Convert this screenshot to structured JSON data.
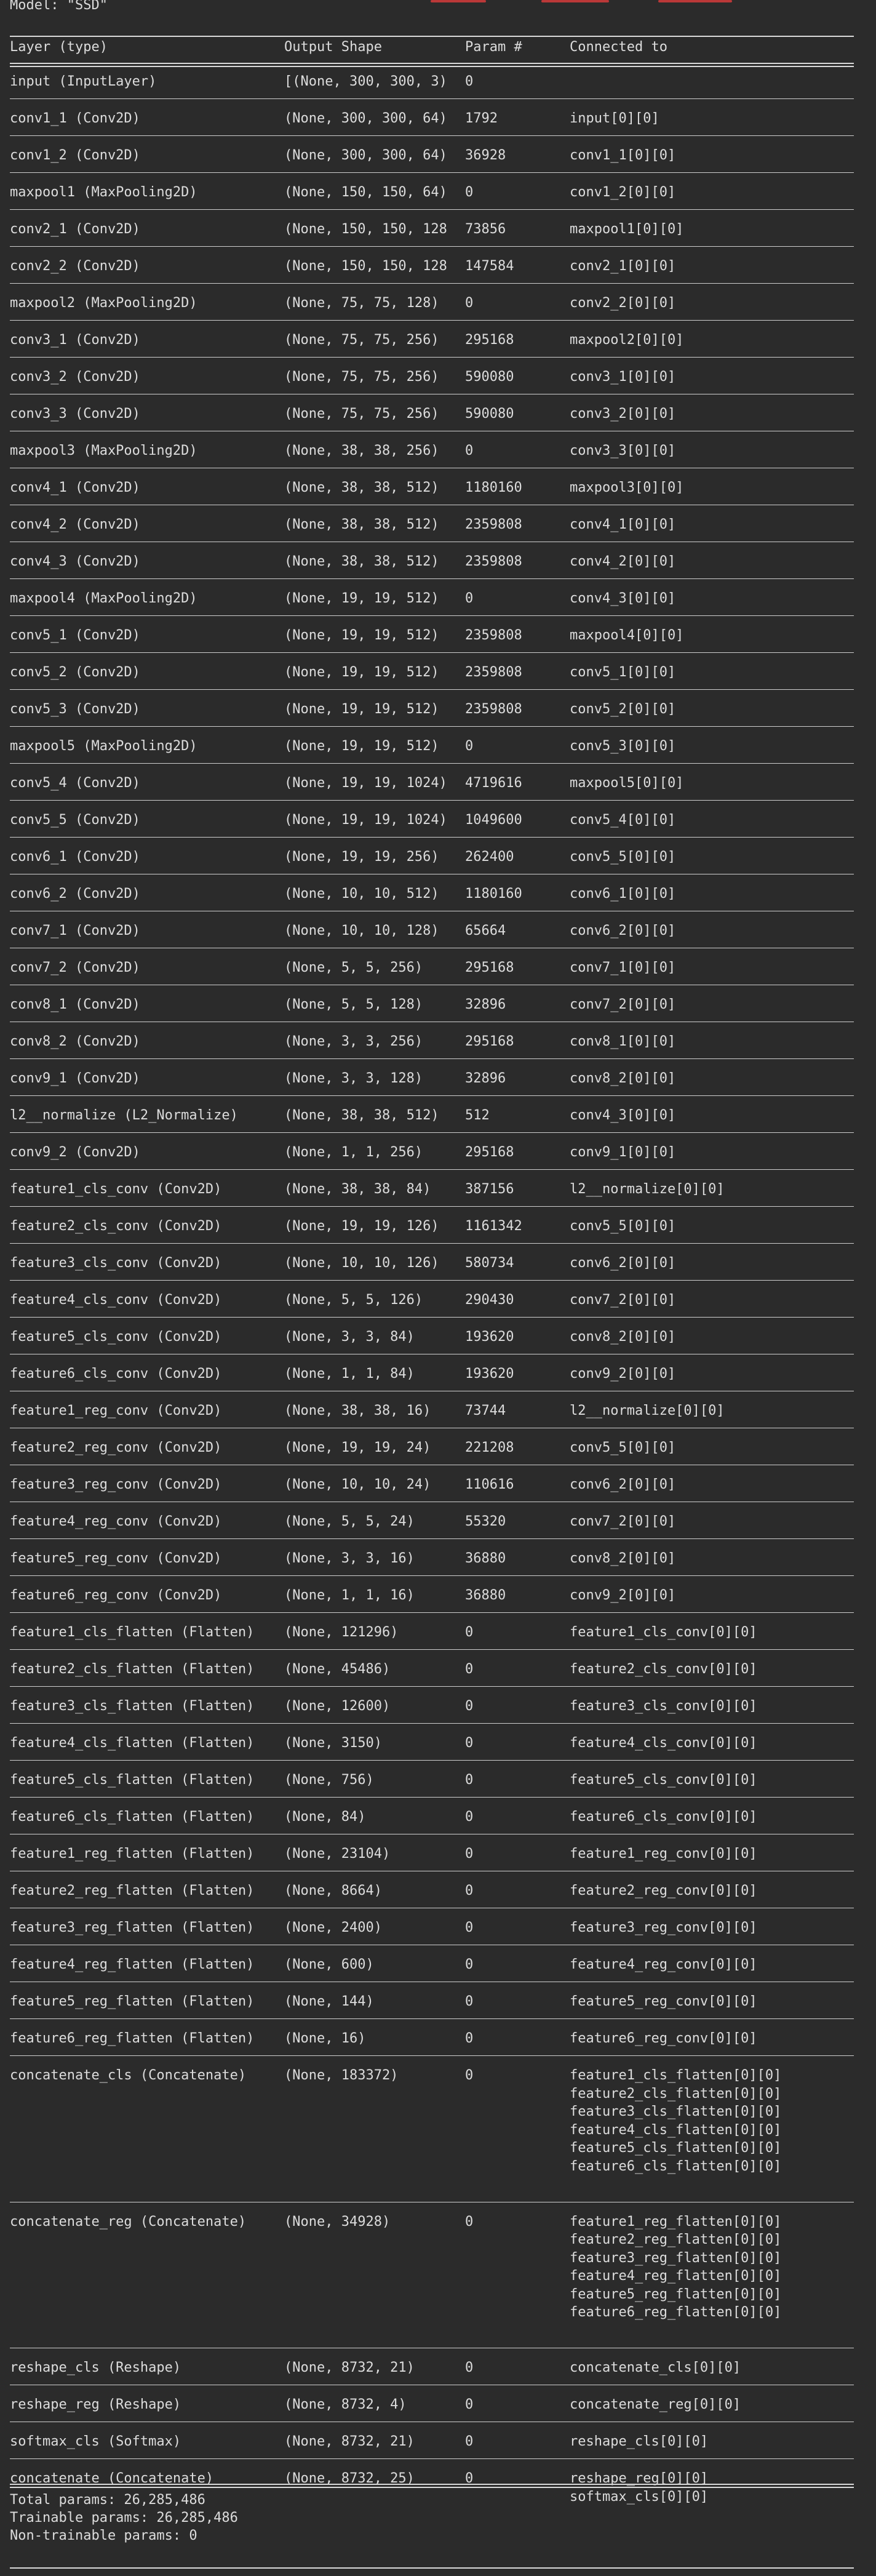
{
  "model_title": "Model: \"SSD\"",
  "header": {
    "layer": "Layer (type)",
    "shape": "Output Shape",
    "param": "Param #",
    "connected": "Connected to"
  },
  "rows": [
    {
      "layer": "input (InputLayer)",
      "shape": "[(None, 300, 300, 3)",
      "param": "0",
      "connected": [
        ""
      ]
    },
    {
      "layer": "conv1_1 (Conv2D)",
      "shape": "(None, 300, 300, 64)",
      "param": "1792",
      "connected": [
        "input[0][0]"
      ]
    },
    {
      "layer": "conv1_2 (Conv2D)",
      "shape": "(None, 300, 300, 64)",
      "param": "36928",
      "connected": [
        "conv1_1[0][0]"
      ]
    },
    {
      "layer": "maxpool1 (MaxPooling2D)",
      "shape": "(None, 150, 150, 64)",
      "param": "0",
      "connected": [
        "conv1_2[0][0]"
      ]
    },
    {
      "layer": "conv2_1 (Conv2D)",
      "shape": "(None, 150, 150, 128",
      "param": "73856",
      "connected": [
        "maxpool1[0][0]"
      ]
    },
    {
      "layer": "conv2_2 (Conv2D)",
      "shape": "(None, 150, 150, 128",
      "param": "147584",
      "connected": [
        "conv2_1[0][0]"
      ]
    },
    {
      "layer": "maxpool2 (MaxPooling2D)",
      "shape": "(None, 75, 75, 128)",
      "param": "0",
      "connected": [
        "conv2_2[0][0]"
      ]
    },
    {
      "layer": "conv3_1 (Conv2D)",
      "shape": "(None, 75, 75, 256)",
      "param": "295168",
      "connected": [
        "maxpool2[0][0]"
      ]
    },
    {
      "layer": "conv3_2 (Conv2D)",
      "shape": "(None, 75, 75, 256)",
      "param": "590080",
      "connected": [
        "conv3_1[0][0]"
      ]
    },
    {
      "layer": "conv3_3 (Conv2D)",
      "shape": "(None, 75, 75, 256)",
      "param": "590080",
      "connected": [
        "conv3_2[0][0]"
      ]
    },
    {
      "layer": "maxpool3 (MaxPooling2D)",
      "shape": "(None, 38, 38, 256)",
      "param": "0",
      "connected": [
        "conv3_3[0][0]"
      ]
    },
    {
      "layer": "conv4_1 (Conv2D)",
      "shape": "(None, 38, 38, 512)",
      "param": "1180160",
      "connected": [
        "maxpool3[0][0]"
      ]
    },
    {
      "layer": "conv4_2 (Conv2D)",
      "shape": "(None, 38, 38, 512)",
      "param": "2359808",
      "connected": [
        "conv4_1[0][0]"
      ]
    },
    {
      "layer": "conv4_3 (Conv2D)",
      "shape": "(None, 38, 38, 512)",
      "param": "2359808",
      "connected": [
        "conv4_2[0][0]"
      ]
    },
    {
      "layer": "maxpool4 (MaxPooling2D)",
      "shape": "(None, 19, 19, 512)",
      "param": "0",
      "connected": [
        "conv4_3[0][0]"
      ]
    },
    {
      "layer": "conv5_1 (Conv2D)",
      "shape": "(None, 19, 19, 512)",
      "param": "2359808",
      "connected": [
        "maxpool4[0][0]"
      ]
    },
    {
      "layer": "conv5_2 (Conv2D)",
      "shape": "(None, 19, 19, 512)",
      "param": "2359808",
      "connected": [
        "conv5_1[0][0]"
      ]
    },
    {
      "layer": "conv5_3 (Conv2D)",
      "shape": "(None, 19, 19, 512)",
      "param": "2359808",
      "connected": [
        "conv5_2[0][0]"
      ]
    },
    {
      "layer": "maxpool5 (MaxPooling2D)",
      "shape": "(None, 19, 19, 512)",
      "param": "0",
      "connected": [
        "conv5_3[0][0]"
      ]
    },
    {
      "layer": "conv5_4 (Conv2D)",
      "shape": "(None, 19, 19, 1024)",
      "param": "4719616",
      "connected": [
        "maxpool5[0][0]"
      ]
    },
    {
      "layer": "conv5_5 (Conv2D)",
      "shape": "(None, 19, 19, 1024)",
      "param": "1049600",
      "connected": [
        "conv5_4[0][0]"
      ]
    },
    {
      "layer": "conv6_1 (Conv2D)",
      "shape": "(None, 19, 19, 256)",
      "param": "262400",
      "connected": [
        "conv5_5[0][0]"
      ]
    },
    {
      "layer": "conv6_2 (Conv2D)",
      "shape": "(None, 10, 10, 512)",
      "param": "1180160",
      "connected": [
        "conv6_1[0][0]"
      ]
    },
    {
      "layer": "conv7_1 (Conv2D)",
      "shape": "(None, 10, 10, 128)",
      "param": "65664",
      "connected": [
        "conv6_2[0][0]"
      ]
    },
    {
      "layer": "conv7_2 (Conv2D)",
      "shape": "(None, 5, 5, 256)",
      "param": "295168",
      "connected": [
        "conv7_1[0][0]"
      ]
    },
    {
      "layer": "conv8_1 (Conv2D)",
      "shape": "(None, 5, 5, 128)",
      "param": "32896",
      "connected": [
        "conv7_2[0][0]"
      ]
    },
    {
      "layer": "conv8_2 (Conv2D)",
      "shape": "(None, 3, 3, 256)",
      "param": "295168",
      "connected": [
        "conv8_1[0][0]"
      ]
    },
    {
      "layer": "conv9_1 (Conv2D)",
      "shape": "(None, 3, 3, 128)",
      "param": "32896",
      "connected": [
        "conv8_2[0][0]"
      ]
    },
    {
      "layer": "l2__normalize (L2_Normalize)",
      "shape": "(None, 38, 38, 512)",
      "param": "512",
      "connected": [
        "conv4_3[0][0]"
      ]
    },
    {
      "layer": "conv9_2 (Conv2D)",
      "shape": "(None, 1, 1, 256)",
      "param": "295168",
      "connected": [
        "conv9_1[0][0]"
      ]
    },
    {
      "layer": "feature1_cls_conv (Conv2D)",
      "shape": "(None, 38, 38, 84)",
      "param": "387156",
      "connected": [
        "l2__normalize[0][0]"
      ]
    },
    {
      "layer": "feature2_cls_conv (Conv2D)",
      "shape": "(None, 19, 19, 126)",
      "param": "1161342",
      "connected": [
        "conv5_5[0][0]"
      ]
    },
    {
      "layer": "feature3_cls_conv (Conv2D)",
      "shape": "(None, 10, 10, 126)",
      "param": "580734",
      "connected": [
        "conv6_2[0][0]"
      ]
    },
    {
      "layer": "feature4_cls_conv (Conv2D)",
      "shape": "(None, 5, 5, 126)",
      "param": "290430",
      "connected": [
        "conv7_2[0][0]"
      ]
    },
    {
      "layer": "feature5_cls_conv (Conv2D)",
      "shape": "(None, 3, 3, 84)",
      "param": "193620",
      "connected": [
        "conv8_2[0][0]"
      ]
    },
    {
      "layer": "feature6_cls_conv (Conv2D)",
      "shape": "(None, 1, 1, 84)",
      "param": "193620",
      "connected": [
        "conv9_2[0][0]"
      ]
    },
    {
      "layer": "feature1_reg_conv (Conv2D)",
      "shape": "(None, 38, 38, 16)",
      "param": "73744",
      "connected": [
        "l2__normalize[0][0]"
      ]
    },
    {
      "layer": "feature2_reg_conv (Conv2D)",
      "shape": "(None, 19, 19, 24)",
      "param": "221208",
      "connected": [
        "conv5_5[0][0]"
      ]
    },
    {
      "layer": "feature3_reg_conv (Conv2D)",
      "shape": "(None, 10, 10, 24)",
      "param": "110616",
      "connected": [
        "conv6_2[0][0]"
      ]
    },
    {
      "layer": "feature4_reg_conv (Conv2D)",
      "shape": "(None, 5, 5, 24)",
      "param": "55320",
      "connected": [
        "conv7_2[0][0]"
      ]
    },
    {
      "layer": "feature5_reg_conv (Conv2D)",
      "shape": "(None, 3, 3, 16)",
      "param": "36880",
      "connected": [
        "conv8_2[0][0]"
      ]
    },
    {
      "layer": "feature6_reg_conv (Conv2D)",
      "shape": "(None, 1, 1, 16)",
      "param": "36880",
      "connected": [
        "conv9_2[0][0]"
      ]
    },
    {
      "layer": "feature1_cls_flatten (Flatten)",
      "shape": "(None, 121296)",
      "param": "0",
      "connected": [
        "feature1_cls_conv[0][0]"
      ]
    },
    {
      "layer": "feature2_cls_flatten (Flatten)",
      "shape": "(None, 45486)",
      "param": "0",
      "connected": [
        "feature2_cls_conv[0][0]"
      ]
    },
    {
      "layer": "feature3_cls_flatten (Flatten)",
      "shape": "(None, 12600)",
      "param": "0",
      "connected": [
        "feature3_cls_conv[0][0]"
      ]
    },
    {
      "layer": "feature4_cls_flatten (Flatten)",
      "shape": "(None, 3150)",
      "param": "0",
      "connected": [
        "feature4_cls_conv[0][0]"
      ]
    },
    {
      "layer": "feature5_cls_flatten (Flatten)",
      "shape": "(None, 756)",
      "param": "0",
      "connected": [
        "feature5_cls_conv[0][0]"
      ]
    },
    {
      "layer": "feature6_cls_flatten (Flatten)",
      "shape": "(None, 84)",
      "param": "0",
      "connected": [
        "feature6_cls_conv[0][0]"
      ]
    },
    {
      "layer": "feature1_reg_flatten (Flatten)",
      "shape": "(None, 23104)",
      "param": "0",
      "connected": [
        "feature1_reg_conv[0][0]"
      ]
    },
    {
      "layer": "feature2_reg_flatten (Flatten)",
      "shape": "(None, 8664)",
      "param": "0",
      "connected": [
        "feature2_reg_conv[0][0]"
      ]
    },
    {
      "layer": "feature3_reg_flatten (Flatten)",
      "shape": "(None, 2400)",
      "param": "0",
      "connected": [
        "feature3_reg_conv[0][0]"
      ]
    },
    {
      "layer": "feature4_reg_flatten (Flatten)",
      "shape": "(None, 600)",
      "param": "0",
      "connected": [
        "feature4_reg_conv[0][0]"
      ]
    },
    {
      "layer": "feature5_reg_flatten (Flatten)",
      "shape": "(None, 144)",
      "param": "0",
      "connected": [
        "feature5_reg_conv[0][0]"
      ]
    },
    {
      "layer": "feature6_reg_flatten (Flatten)",
      "shape": "(None, 16)",
      "param": "0",
      "connected": [
        "feature6_reg_conv[0][0]"
      ]
    },
    {
      "layer": "concatenate_cls (Concatenate)",
      "shape": "(None, 183372)",
      "param": "0",
      "connected": [
        "feature1_cls_flatten[0][0]",
        "feature2_cls_flatten[0][0]",
        "feature3_cls_flatten[0][0]",
        "feature4_cls_flatten[0][0]",
        "feature5_cls_flatten[0][0]",
        "feature6_cls_flatten[0][0]"
      ]
    },
    {
      "layer": "concatenate_reg (Concatenate)",
      "shape": "(None, 34928)",
      "param": "0",
      "connected": [
        "feature1_reg_flatten[0][0]",
        "feature2_reg_flatten[0][0]",
        "feature3_reg_flatten[0][0]",
        "feature4_reg_flatten[0][0]",
        "feature5_reg_flatten[0][0]",
        "feature6_reg_flatten[0][0]"
      ]
    },
    {
      "layer": "reshape_cls (Reshape)",
      "shape": "(None, 8732, 21)",
      "param": "0",
      "connected": [
        "concatenate_cls[0][0]"
      ]
    },
    {
      "layer": "reshape_reg (Reshape)",
      "shape": "(None, 8732, 4)",
      "param": "0",
      "connected": [
        "concatenate_reg[0][0]"
      ]
    },
    {
      "layer": "softmax_cls (Softmax)",
      "shape": "(None, 8732, 21)",
      "param": "0",
      "connected": [
        "reshape_cls[0][0]"
      ]
    },
    {
      "layer": "concatenate (Concatenate)",
      "shape": "(None, 8732, 25)",
      "param": "0",
      "connected": [
        "reshape_reg[0][0]",
        "softmax_cls[0][0]"
      ]
    }
  ],
  "summary": {
    "total": "Total params: 26,285,486",
    "trainable": "Trainable params: 26,285,486",
    "non_trainable": "Non-trainable params: 0"
  },
  "colors": {
    "background": "#2b2b2b",
    "text": "#dcdcdc",
    "rule": "#d9d9d9",
    "accent_red": "#d33b3b"
  }
}
